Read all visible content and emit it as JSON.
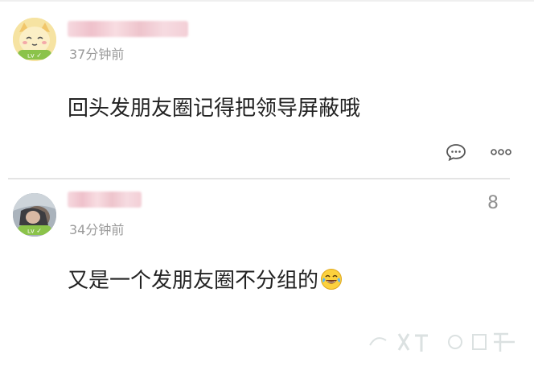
{
  "comments": [
    {
      "time": "37分钟前",
      "content": "回头发朋友圈记得把领导屏蔽哦",
      "avatar_icon": "cartoon-face-icon",
      "actions": [
        "comment-icon",
        "more-icon"
      ]
    },
    {
      "time": "34分钟前",
      "content": "又是一个发朋友圈不分组的",
      "emoji": "laughing-tears-emoji",
      "floor": "8",
      "avatar_icon": "photo-avatar-icon"
    }
  ],
  "colors": {
    "text_main": "#222222",
    "text_meta": "#9a9a9a",
    "divider": "#e4e4e4"
  }
}
